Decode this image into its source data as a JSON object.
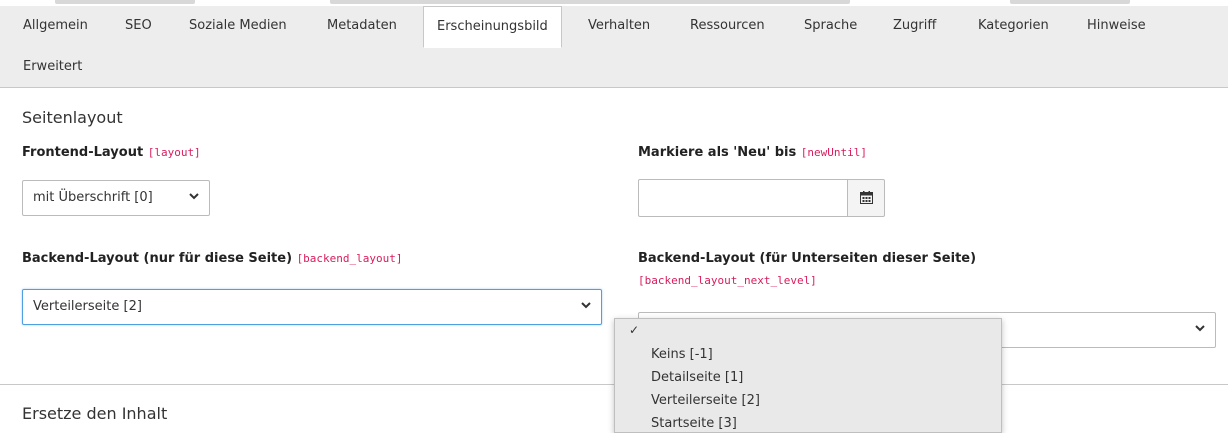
{
  "tabs": [
    {
      "label": "Allgemein"
    },
    {
      "label": "SEO"
    },
    {
      "label": "Soziale Medien"
    },
    {
      "label": "Metadaten"
    },
    {
      "label": "Erscheinungsbild",
      "active": true
    },
    {
      "label": "Verhalten"
    },
    {
      "label": "Ressourcen"
    },
    {
      "label": "Sprache"
    },
    {
      "label": "Zugriff"
    },
    {
      "label": "Kategorien"
    },
    {
      "label": "Hinweise"
    },
    {
      "label": "Erweitert"
    }
  ],
  "page_layout": {
    "title": "Seitenlayout",
    "frontend_layout": {
      "label": "Frontend-Layout",
      "field": "[layout]",
      "value": "mit Überschrift [0]"
    },
    "new_until": {
      "label": "Markiere als 'Neu' bis",
      "field": "[newUntil]",
      "value": ""
    },
    "backend_layout": {
      "label": "Backend-Layout (nur für diese Seite)",
      "field": "[backend_layout]",
      "value": "Verteilerseite [2]"
    },
    "backend_layout_next": {
      "label": "Backend-Layout (für Unterseiten dieser Seite)",
      "field": "[backend_layout_next_level]",
      "value": ""
    }
  },
  "content_section": {
    "title": "Ersetze den Inhalt"
  },
  "dropdown": {
    "checkmark": "✓",
    "options": [
      "Keins [-1]",
      "Detailseite [1]",
      "Verteilerseite [2]",
      "Startseite [3]"
    ]
  },
  "icons": {
    "select_arrow": "chevron-down-icon",
    "date_picker": "calendar-icon",
    "selected": "checkmark-icon"
  }
}
